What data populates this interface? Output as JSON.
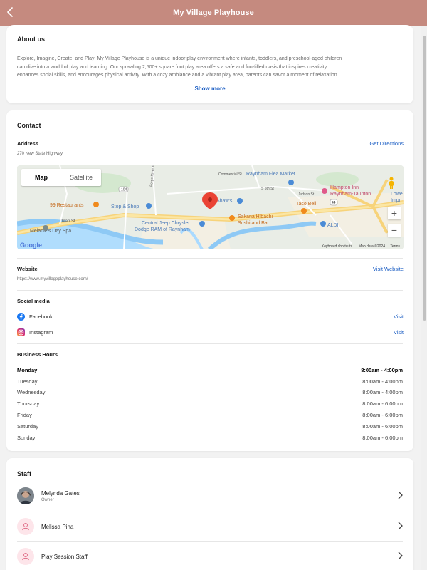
{
  "header": {
    "title": "My Village Playhouse",
    "back_icon": "chevron-left-icon"
  },
  "about": {
    "title": "About us",
    "text_line1": "Explore, Imagine, Create, and Play! My Village Playhouse is a unique indoor play environment where infants, toddlers, and preschool-aged children",
    "text_line2": "can dive into a world of play and learning. Our sprawling 2,500+ square foot play area offers a safe and fun-filled oasis that inspires creativity,",
    "text_line3": "enhances social skills, and encourages physical activity. With a cozy ambiance and a vibrant play area, parents can savor a moment of relaxation...",
    "show_more": "Show more"
  },
  "contact": {
    "title": "Contact",
    "address_label": "Address",
    "address_value": "270 New State Highway",
    "directions_link": "Get Directions",
    "map": {
      "tab_map": "Map",
      "tab_satellite": "Satellite",
      "zoom_in": "+",
      "zoom_out": "−",
      "google": "Google",
      "keyboard_shortcuts": "Keyboard shortcuts",
      "map_data": "Map data ©2024",
      "terms": "Terms",
      "labels": {
        "flea_market": "Raynham Flea Market",
        "hampton1": "Hampton Inn",
        "hampton2": "Raynham-Taunton",
        "lowe1": "Lowe",
        "lowe2": "Impr",
        "shaws": "Shaw's",
        "stop_shop": "Stop & Shop",
        "restaurants": "99 Restaurants",
        "taco_bell": "Taco Bell",
        "jeep1": "Central Jeep Chrysler",
        "jeep2": "Dodge RAM of Raynham",
        "sakana1": "Sakana Hibachi",
        "sakana2": "Sushi and Bar",
        "aldi": "ALDI",
        "melanie": "Melanie's Day Spa",
        "dean": "Dean St",
        "route104": "104",
        "route44": "44",
        "judson": "Judson St",
        "s5th": "S 5th St",
        "commercial": "Commercial St",
        "forge_river": "Forge River Pkwy"
      }
    },
    "website_label": "Website",
    "website_value": "https://www.myvillageplayhouse.com/",
    "website_link": "Visit Website",
    "social_label": "Social media",
    "social": [
      {
        "name": "Facebook",
        "icon": "facebook-icon",
        "link": "Visit",
        "color": "#1877f2"
      },
      {
        "name": "Instagram",
        "icon": "instagram-icon",
        "link": "Visit",
        "color": "#d6249f"
      }
    ],
    "hours_label": "Business Hours",
    "hours": [
      {
        "day": "Monday",
        "time": "8:00am - 4:00pm"
      },
      {
        "day": "Tuesday",
        "time": "8:00am - 4:00pm"
      },
      {
        "day": "Wednesday",
        "time": "8:00am - 4:00pm"
      },
      {
        "day": "Thursday",
        "time": "8:00am - 6:00pm"
      },
      {
        "day": "Friday",
        "time": "8:00am - 6:00pm"
      },
      {
        "day": "Saturday",
        "time": "8:00am - 6:00pm"
      },
      {
        "day": "Sunday",
        "time": "8:00am - 6:00pm"
      }
    ]
  },
  "staff": {
    "title": "Staff",
    "members": [
      {
        "name": "Melynda Gates",
        "role": "Owner"
      },
      {
        "name": "Melissa Pina",
        "role": ""
      },
      {
        "name": "Play Session Staff",
        "role": ""
      }
    ]
  },
  "colors": {
    "header": "#c58a7f",
    "link": "#1d5fc4",
    "avatar_bg": "#fde5ea",
    "avatar_icon": "#e0708a"
  }
}
